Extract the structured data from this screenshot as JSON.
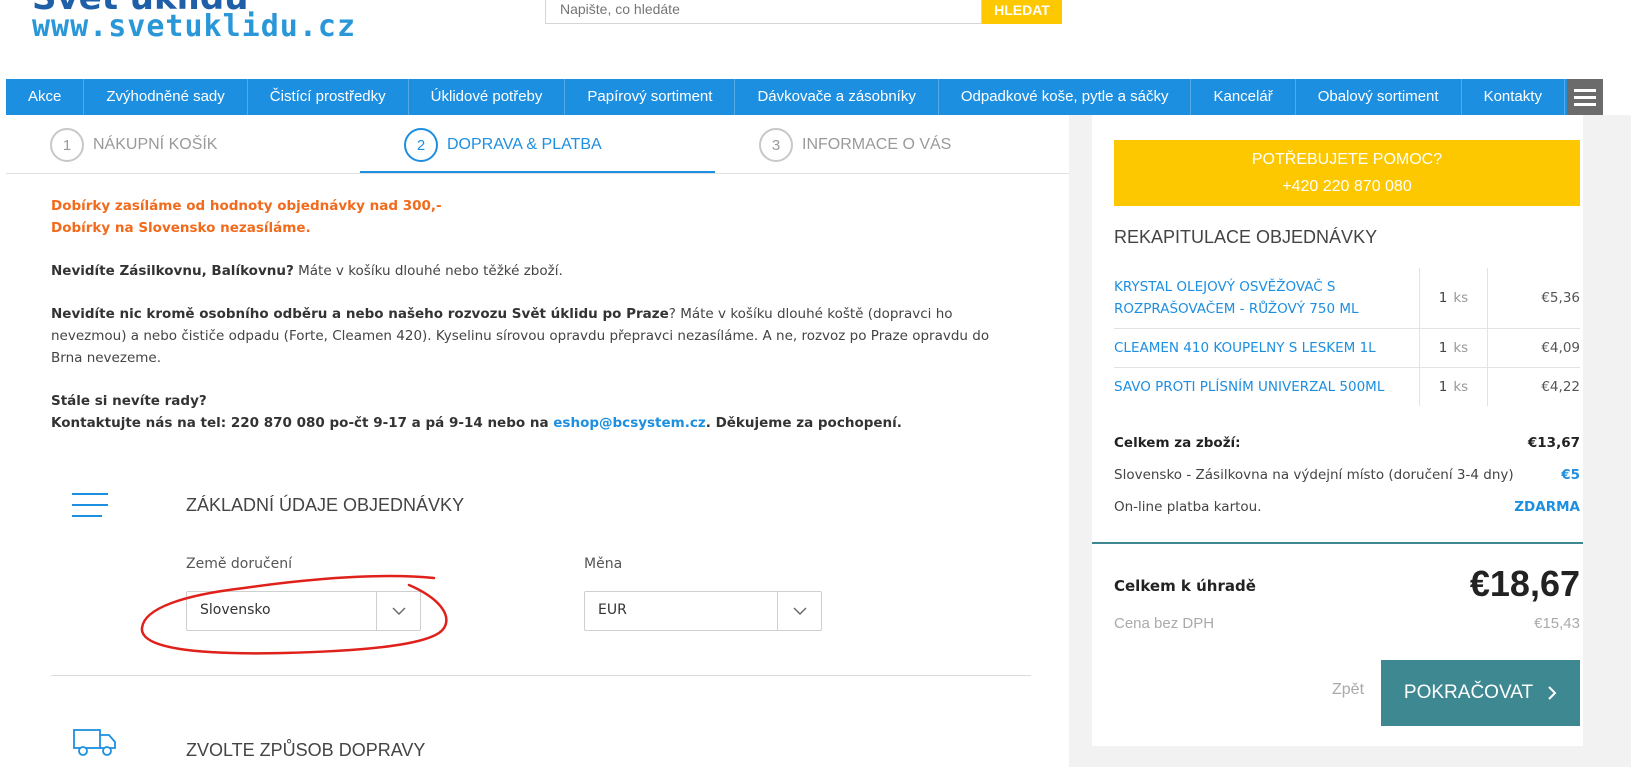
{
  "header": {
    "brand_text": "Svět úklidu",
    "url_text": "www.svetuklidu.cz",
    "search_placeholder": "Napište, co hledáte",
    "search_button": "HLEDAT"
  },
  "nav": {
    "items": [
      "Akce",
      "Zvýhodněné sady",
      "Čistící prostředky",
      "Úklidové potřeby",
      "Papírový sortiment",
      "Dávkovače a zásobníky",
      "Odpadkové koše, pytle a sáčky",
      "Kancelář",
      "Obalový sortiment",
      "Kontakty"
    ],
    "menu_icon": "hamburger-icon"
  },
  "steps": [
    {
      "num": "1",
      "label": "NÁKUPNÍ KOŠÍK"
    },
    {
      "num": "2",
      "label": "DOPRAVA & PLATBA"
    },
    {
      "num": "3",
      "label": "INFORMACE O VÁS"
    }
  ],
  "info": {
    "warn1": "Dobírky zasíláme od hodnoty objednávky nad 300,-",
    "warn2": "Dobírky na Slovensko nezasíláme.",
    "p2_bold": "Nevidíte Zásilkovnu, Balíkovnu?",
    "p2_text": " Máte v košíku dlouhé nebo těžké zboží.",
    "p3_bold": "Nevidíte nic kromě osobního odběru a nebo našeho rozvozu Svět úklidu po Praze",
    "p3_text": "?  Máte v košíku dlouhé koště (dopravci ho nevezmou) a nebo čističe odpadu (Forte, Cleamen 420). Kyselinu sírovou opravdu přepravci nezasíláme.  A ne, rozvoz po Praze opravdu do Brna nevezeme.",
    "p4_line1": "Stále si nevíte rady?",
    "p4_line2a": "Kontaktujte nás na tel: 220 870 080 po-čt 9-17 a pá 9-14 nebo na ",
    "p4_email": "eshop@bcsystem.cz",
    "p4_line2b": ". Děkujeme za pochopení."
  },
  "basic": {
    "title": "ZÁKLADNÍ ÚDAJE OBJEDNÁVKY",
    "country_label": "Země doručení",
    "country_value": "Slovensko",
    "currency_label": "Měna",
    "currency_value": "EUR"
  },
  "shipping": {
    "title": "ZVOLTE ZPŮSOB DOPRAVY"
  },
  "summary": {
    "help_line1": "POTŘEBUJETE POMOC?",
    "help_line2": "+420 220 870 080",
    "title": "REKAPITULACE OBJEDNÁVKY",
    "items": [
      {
        "name": "KRYSTAL OLEJOVÝ OSVĚŽOVAČ S ROZPRAŠOVAČEM - RŮŽOVÝ 750 ML",
        "qty": "1",
        "unit": "ks",
        "price": "€5,36"
      },
      {
        "name": "CLEAMEN 410 KOUPELNY S LESKEM 1L",
        "qty": "1",
        "unit": "ks",
        "price": "€4,09"
      },
      {
        "name": "SAVO PROTI PLÍSNÍM UNIVERZAL 500ML",
        "qty": "1",
        "unit": "ks",
        "price": "€4,22"
      }
    ],
    "goods_total_label": "Celkem za zboží:",
    "goods_total_value": "€13,67",
    "shipping_label": "Slovensko - Zásilkovna na výdejní místo (doručení 3-4 dny)",
    "shipping_value": "€5",
    "payment_label": "On-line platba kartou.",
    "payment_value": "ZDARMA",
    "grand_label": "Celkem k úhradě",
    "grand_value": "€18,67",
    "net_label": "Cena bez DPH",
    "net_value": "€15,43",
    "back_label": "Zpět",
    "continue_label": "POKRAČOVAT"
  },
  "colors": {
    "accent": "#1d8fe1",
    "yellow": "#fec800",
    "teal": "#3d8891",
    "warning": "#f26a1b"
  }
}
